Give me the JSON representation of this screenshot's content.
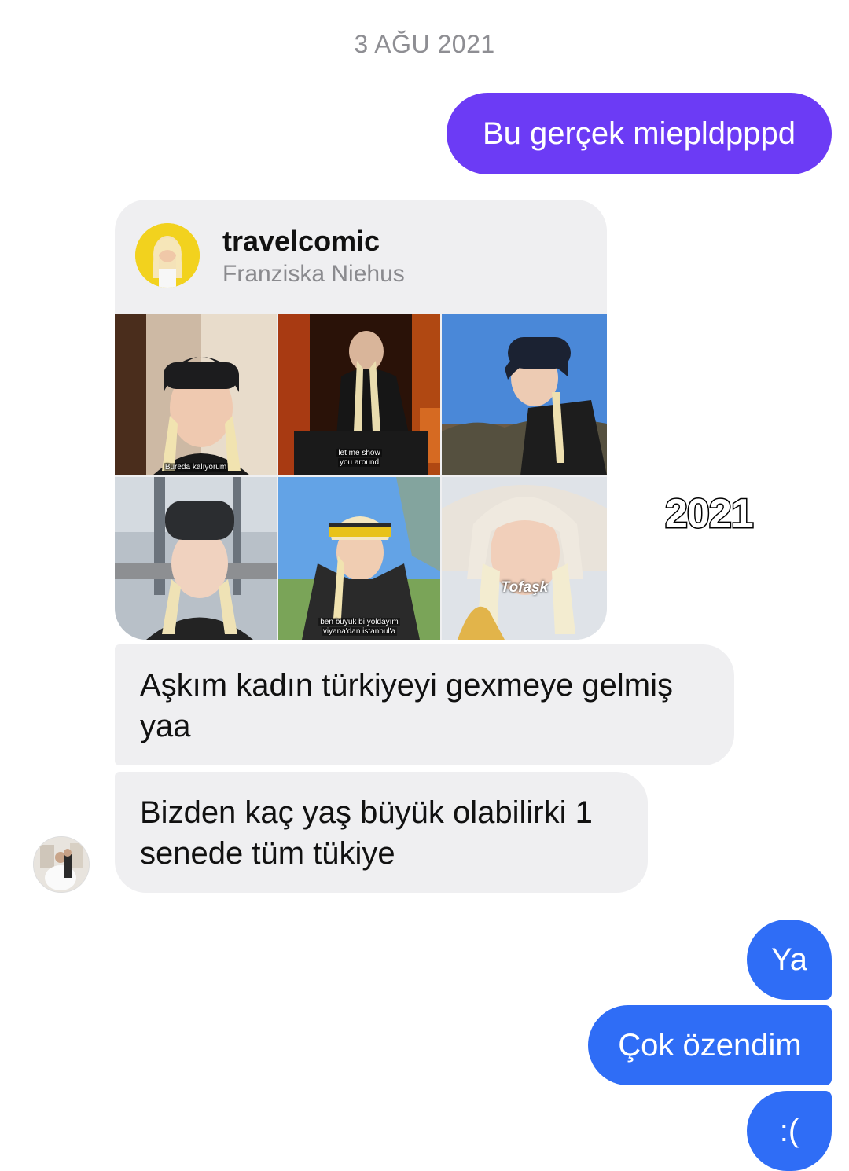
{
  "date_separator": "3 AĞU 2021",
  "colors": {
    "outgoing_purple": "#6c3bf5",
    "outgoing_blue": "#2f6df6",
    "incoming_bg": "#efeff1"
  },
  "messages_out_top": [
    {
      "text": "Bu gerçek miepldpppd"
    }
  ],
  "shared_post": {
    "username": "travelcomic",
    "full_name": "Franziska Niehus",
    "tiles": [
      {
        "caption": "Bureda kalıyorum"
      },
      {
        "caption_line1": "let me show",
        "caption_line2": "you around"
      },
      {
        "caption": ""
      },
      {
        "caption": ""
      },
      {
        "caption_line1": "ben büyük bi yoldayım",
        "caption_line2": "viyana'dan istanbul'a"
      },
      {
        "caption": "Tofaşk"
      }
    ]
  },
  "overlay_text": "2021",
  "messages_in": [
    {
      "text": "Aşkım kadın türkiyeyi gexmeye gelmiş yaa"
    },
    {
      "text": "Bizden kaç yaş büyük olabilirki 1 senede tüm tükiye"
    }
  ],
  "messages_out_bottom": [
    {
      "text": "Ya"
    },
    {
      "text": "Çok özendim"
    },
    {
      "text": ":("
    }
  ]
}
